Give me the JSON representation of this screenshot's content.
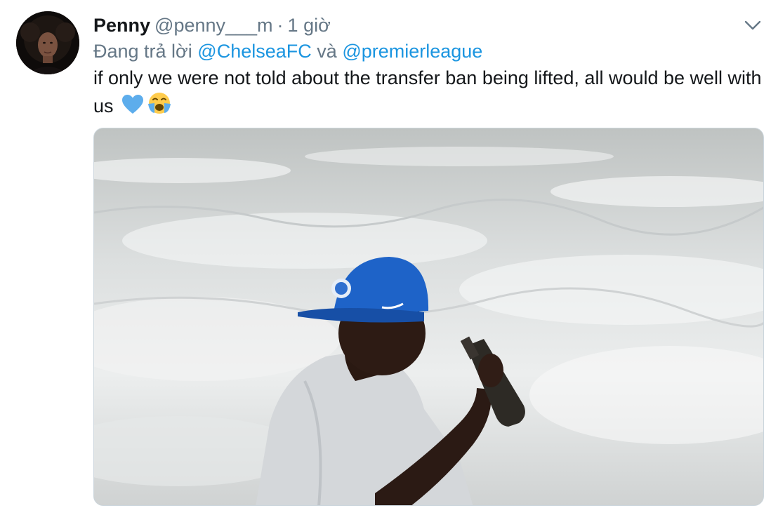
{
  "tweet": {
    "display_name": "Penny",
    "handle": "@penny___m",
    "separator": "·",
    "time": "1 giờ",
    "reply_prefix": "Đang trả lời",
    "reply_to_1": "@ChelseaFC",
    "reply_joiner": "và",
    "reply_to_2": "@premierleague",
    "text_line": "if only we were not told about the transfer ban being lifted, all would be well with us",
    "emojis": [
      "blue-heart-icon",
      "loudly-crying-face-icon"
    ]
  },
  "media": {
    "description_icon": "photo",
    "cap_color": "#1e63c8",
    "shirt_color": "#d9dcdf",
    "sea_color": "#e8ebec"
  },
  "colors": {
    "link": "#1b95e0",
    "secondary_text": "#657786",
    "primary_text": "#14171a"
  }
}
